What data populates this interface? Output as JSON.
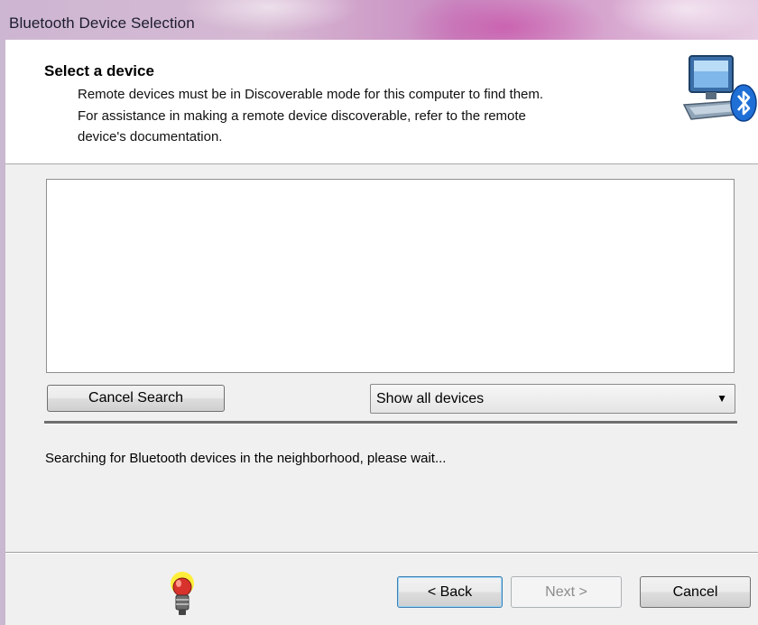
{
  "window": {
    "title": "Bluetooth Device Selection"
  },
  "header": {
    "heading": "Select a device",
    "lines": [
      "Remote devices must be in Discoverable mode for this computer to find them.",
      "For assistance in making a remote device discoverable, refer to the remote",
      "device's documentation."
    ]
  },
  "device_list": {
    "items": []
  },
  "controls": {
    "cancel_search_label": "Cancel Search",
    "filter_selected": "Show all devices"
  },
  "status_text": "Searching for Bluetooth devices in the neighborhood, please wait...",
  "footer": {
    "back_label": "< Back",
    "next_label": "Next >",
    "cancel_label": "Cancel"
  },
  "icons": {
    "header_graphic": "bluetooth-computer-icon",
    "tip_icon": "lightbulb-icon"
  },
  "colors": {
    "bluetooth_blue": "#1f6fd6",
    "title_bar": "#c98bc1"
  }
}
